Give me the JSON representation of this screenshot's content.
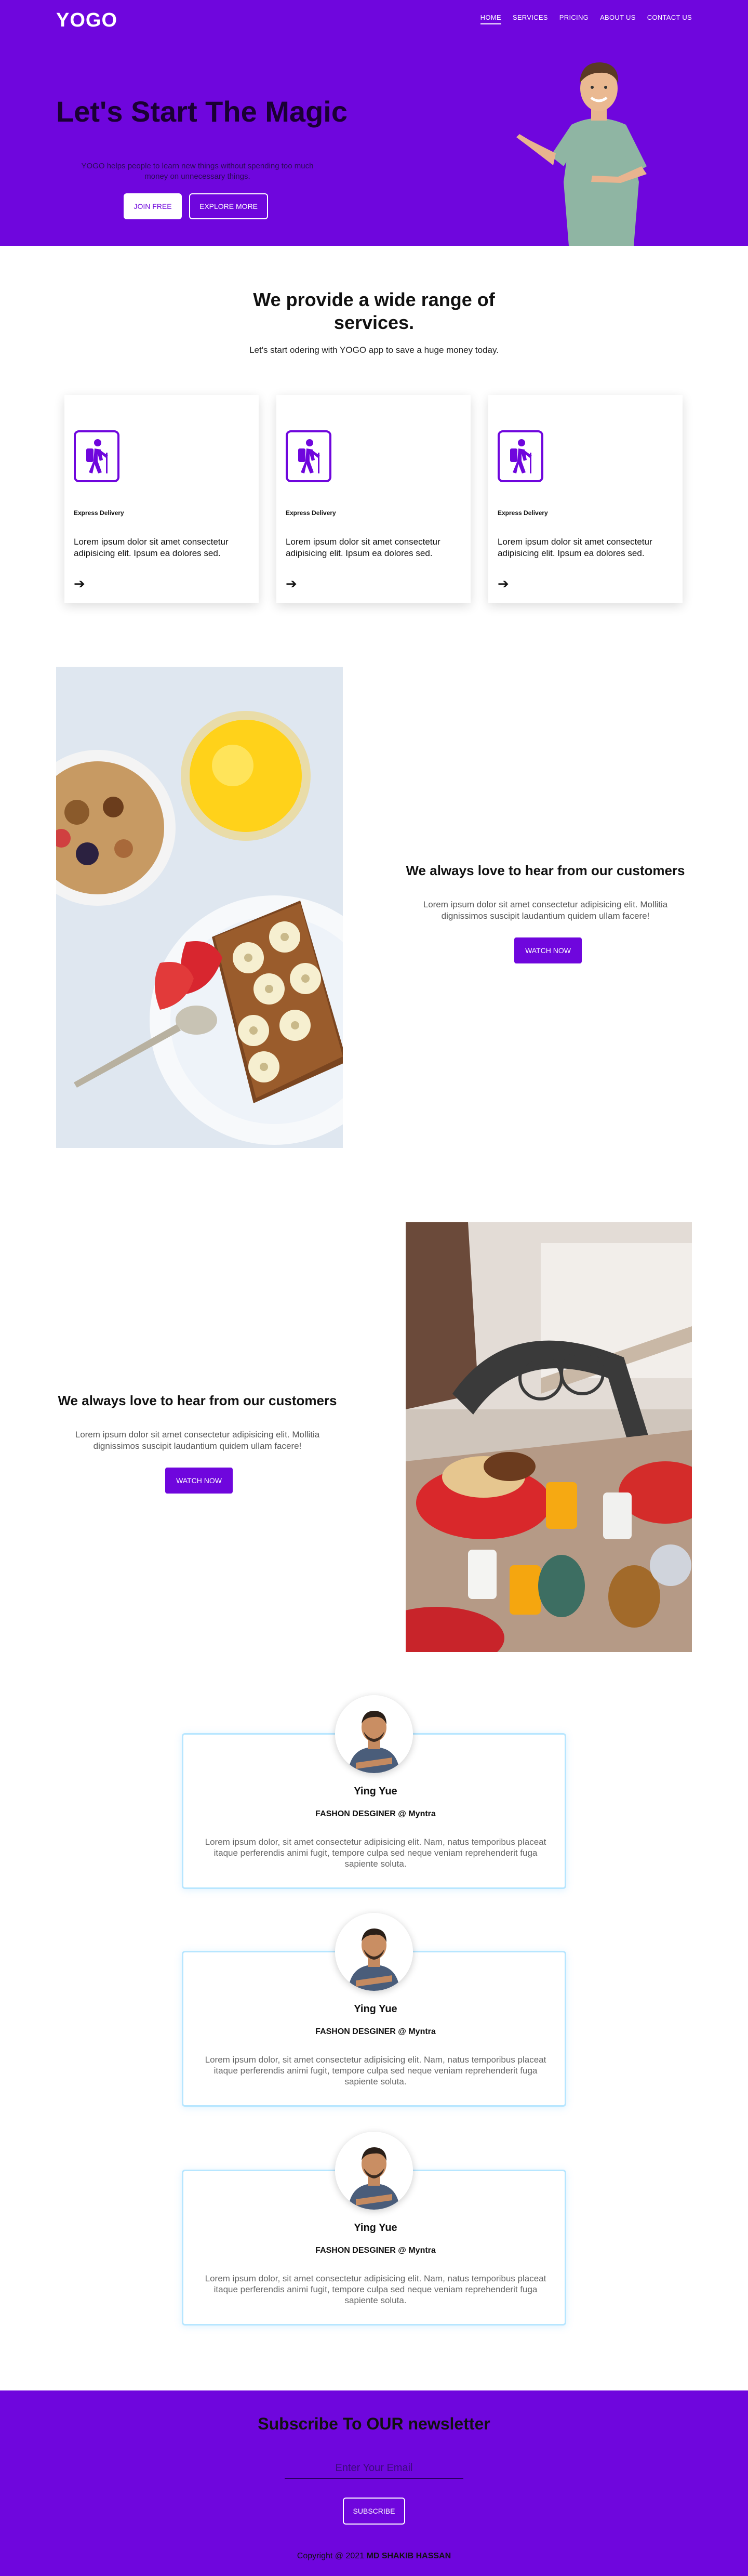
{
  "header": {
    "logo": "YOGO",
    "nav": [
      "HOME",
      "SERVICES",
      "PRICING",
      "ABOUT US",
      "CONTACT US"
    ]
  },
  "hero": {
    "title": "Let's Start The Magic",
    "description": "YOGO helps people to learn new things without spending too much money on unnecessary things.",
    "join_label": "JOIN FREE",
    "explore_label": "EXPLORE MORE"
  },
  "services": {
    "heading": "We provide a wide range of services.",
    "subheading": "Let's start odering with YOGO app to save a huge money today.",
    "cards": [
      {
        "title": "Express Delivery",
        "text": "Lorem ipsum dolor sit amet consectetur adipisicing elit. Ipsum ea dolores sed.",
        "icon": "hiker-icon",
        "arrow": "arrow-right-icon"
      },
      {
        "title": "Express Delivery",
        "text": "Lorem ipsum dolor sit amet consectetur adipisicing elit. Ipsum ea dolores sed.",
        "icon": "hiker-icon",
        "arrow": "arrow-right-icon"
      },
      {
        "title": "Express Delivery",
        "text": "Lorem ipsum dolor sit amet consectetur adipisicing elit. Ipsum ea dolores sed.",
        "icon": "hiker-icon",
        "arrow": "arrow-right-icon"
      }
    ]
  },
  "feature_1": {
    "title": "We always love to hear from our customers",
    "text": "Lorem ipsum dolor sit amet consectetur adipisicing elit. Mollitia dignissimos suscipit laudantium quidem ullam facere!",
    "button_label": "WATCH NOW"
  },
  "feature_2": {
    "title": "We always love to hear from our customers",
    "text": "Lorem ipsum dolor sit amet consectetur adipisicing elit. Mollitia dignissimos suscipit laudantium quidem ullam facere!",
    "button_label": "WATCH NOW"
  },
  "testimonials": [
    {
      "name": "Ying Yue",
      "role": "FASHON DESGINER @ Myntra",
      "text": "Lorem ipsum dolor, sit amet consectetur adipisicing elit. Nam, natus temporibus placeat itaque perferendis animi fugit, tempore culpa sed neque veniam reprehenderit fuga sapiente soluta."
    },
    {
      "name": "Ying Yue",
      "role": "FASHON DESGINER @ Myntra",
      "text": "Lorem ipsum dolor, sit amet consectetur adipisicing elit. Nam, natus temporibus placeat itaque perferendis animi fugit, tempore culpa sed neque veniam reprehenderit fuga sapiente soluta."
    },
    {
      "name": "Ying Yue",
      "role": "FASHON DESGINER @ Myntra",
      "text": "Lorem ipsum dolor, sit amet consectetur adipisicing elit. Nam, natus temporibus placeat itaque perferendis animi fugit, tempore culpa sed neque veniam reprehenderit fuga sapiente soluta."
    }
  ],
  "newsletter": {
    "title": "Subscribe To OUR newsletter",
    "placeholder": "Enter Your Email",
    "button_label": "SUBSCRIBE",
    "copyright_prefix": "Copyright @ 2021",
    "copyright_author": "MD SHAKIB HASSAN"
  },
  "colors": {
    "brand": "#6f06dd",
    "card_border": "#b7e6ff",
    "white": "#ffffff"
  }
}
